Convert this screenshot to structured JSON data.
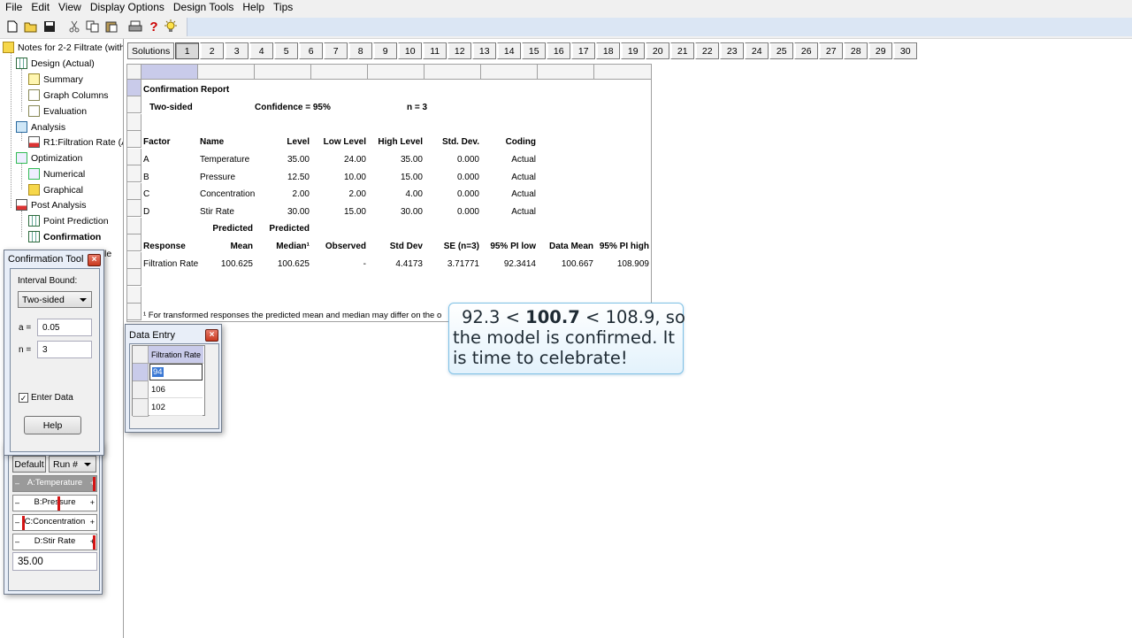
{
  "menu": [
    "File",
    "Edit",
    "View",
    "Display Options",
    "Design Tools",
    "Help",
    "Tips"
  ],
  "toolbar_icons": [
    "new-file-icon",
    "open-folder-icon",
    "save-icon",
    "cut-icon",
    "copy-icon",
    "paste-icon",
    "print-icon",
    "help-icon",
    "tip-bulb-icon"
  ],
  "tree": {
    "root": "Notes for 2-2 Filtrate (with",
    "design": "Design (Actual)",
    "summary": "Summary",
    "graph_columns": "Graph Columns",
    "evaluation": "Evaluation",
    "analysis": "Analysis",
    "r1": "R1:Filtration Rate (A",
    "optimization": "Optimization",
    "numerical": "Numerical",
    "graphical": "Graphical",
    "post_analysis": "Post Analysis",
    "point_prediction": "Point Prediction",
    "confirmation": "Confirmation",
    "partial": "le"
  },
  "solutions": {
    "label": "Solutions",
    "tabs": [
      "1",
      "2",
      "3",
      "4",
      "5",
      "6",
      "7",
      "8",
      "9",
      "10",
      "11",
      "12",
      "13",
      "14",
      "15",
      "16",
      "17",
      "18",
      "19",
      "20",
      "21",
      "22",
      "23",
      "24",
      "25",
      "26",
      "27",
      "28",
      "29",
      "30"
    ]
  },
  "report": {
    "title": "Confirmation Report",
    "two_sided": "Two-sided",
    "confidence": "Confidence = 95%",
    "n": "n =   3",
    "factor_headers": [
      "Factor",
      "Name",
      "Level",
      "Low Level",
      "High Level",
      "Std. Dev.",
      "Coding"
    ],
    "factors": [
      [
        "A",
        "Temperature",
        "35.00",
        "24.00",
        "35.00",
        "0.000",
        "Actual"
      ],
      [
        "B",
        "Pressure",
        "12.50",
        "10.00",
        "15.00",
        "0.000",
        "Actual"
      ],
      [
        "C",
        "Concentration",
        "2.00",
        "2.00",
        "4.00",
        "0.000",
        "Actual"
      ],
      [
        "D",
        "Stir Rate",
        "30.00",
        "15.00",
        "30.00",
        "0.000",
        "Actual"
      ]
    ],
    "pred_top": [
      "Predicted",
      "Predicted"
    ],
    "response_headers": [
      "Response",
      "Mean",
      "Median¹",
      "Observed",
      "Std Dev",
      "SE (n=3)",
      "95% PI low",
      "Data Mean",
      "95% PI high"
    ],
    "response_row": [
      "Filtration Rate",
      "100.625",
      "100.625",
      "-",
      "4.4173",
      "3.71771",
      "92.3414",
      "100.667",
      "108.909"
    ],
    "footnote": "¹ For transformed responses the predicted mean and median may differ on the o"
  },
  "confirmation_tool": {
    "title": "Confirmation Tool",
    "interval_label": "Interval Bound:",
    "interval_value": "Two-sided",
    "alpha_label": "a =",
    "alpha_value": "0.05",
    "n_label": "n =",
    "n_value": "3",
    "enter_data_label": "Enter Data",
    "enter_data_checked": true,
    "help_label": "Help"
  },
  "factors_tool": {
    "default_label": "Default",
    "run_label": "Run #",
    "sliders": [
      {
        "name": "A:Temperature",
        "level": 1.0,
        "minus": "–",
        "plus": "+"
      },
      {
        "name": "B:Pressure",
        "level": 0.5,
        "minus": "–",
        "plus": "+"
      },
      {
        "name": "C:Concentration",
        "level": 0.0,
        "minus": "–",
        "plus": "+"
      },
      {
        "name": "D:Stir Rate",
        "level": 1.0,
        "minus": "–",
        "plus": "+"
      }
    ],
    "value": "35.00"
  },
  "data_entry": {
    "title": "Data Entry",
    "column_header": "Filtration Rate",
    "values": [
      "94",
      "106",
      "102"
    ]
  },
  "callout": {
    "line1_a": "92.3 < ",
    "line1_b": "100.7",
    "line1_c": " < 108.9, so",
    "line2": "the model is confirmed.  It",
    "line3": "is time to celebrate!"
  }
}
